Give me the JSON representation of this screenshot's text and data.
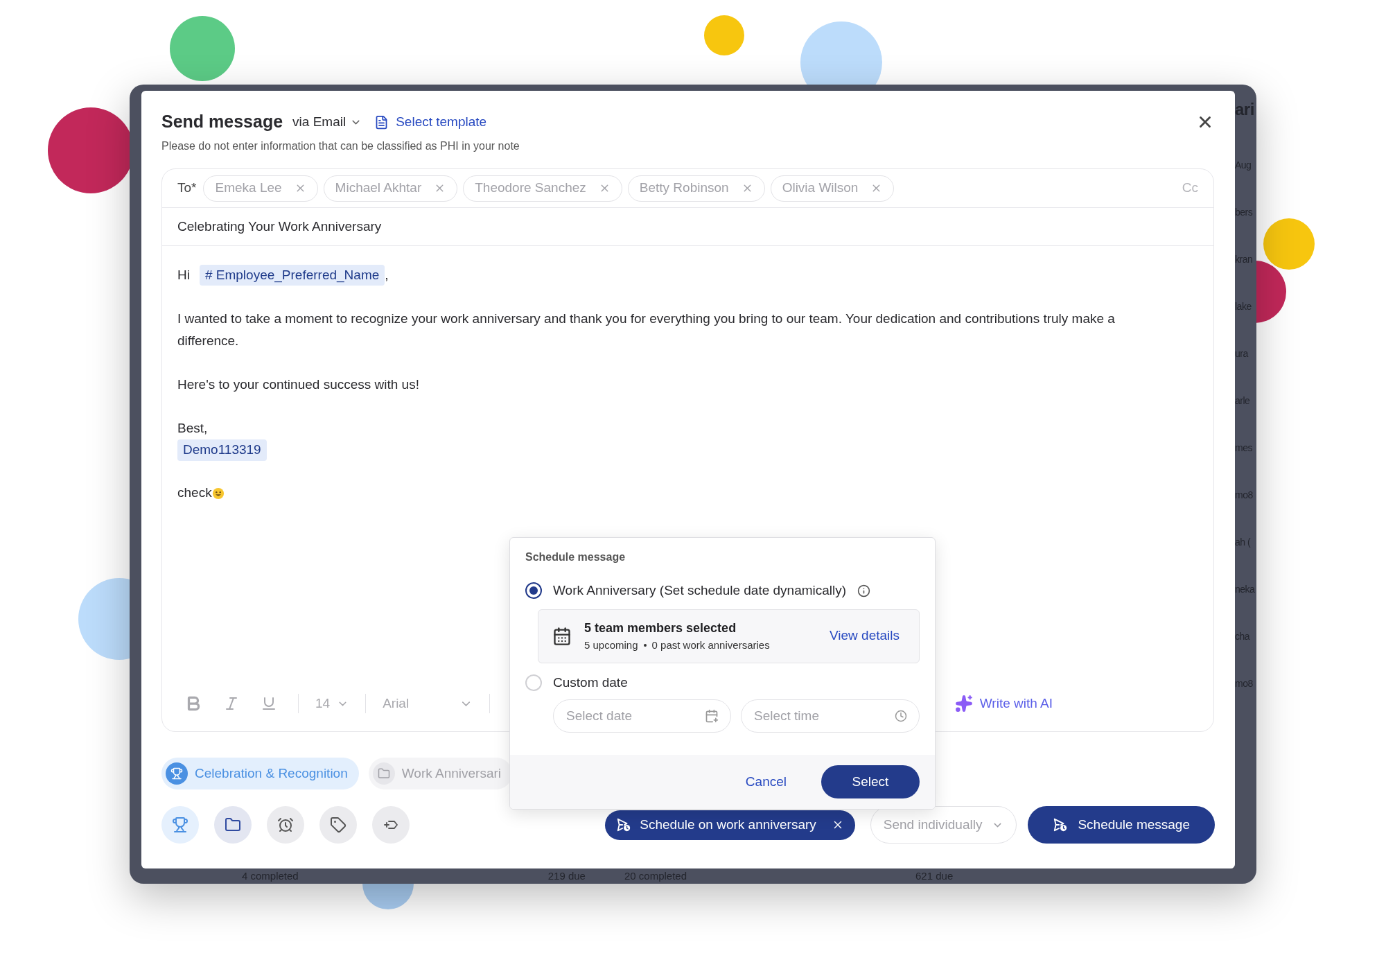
{
  "background": {
    "right_column": [
      "ari",
      "Aug",
      "bers",
      "kran",
      "lake",
      "ura",
      "arle",
      "mes",
      "mo8",
      "ah (",
      "neka",
      "cha",
      "mo8"
    ],
    "footer": [
      "4 completed",
      "219 due",
      "20 completed",
      "621 due"
    ]
  },
  "dialog": {
    "title": "Send message",
    "channel": "via Email",
    "template_link": "Select template",
    "notice": "Please do not enter information that can be classified as PHI in your note",
    "to_label": "To*",
    "recipients": [
      "Emeka Lee",
      "Michael Akhtar",
      "Theodore Sanchez",
      "Betty Robinson",
      "Olivia Wilson"
    ],
    "cc": "Cc",
    "subject": "Celebrating Your Work Anniversary",
    "body": [
      {
        "kind": "greeting",
        "text": "Hi",
        "tag": "# Employee_Preferred_Name",
        "after": ","
      },
      {
        "kind": "paragraph",
        "text": "I wanted to take a moment to recognize your work anniversary and thank you for everything you bring to our team. Your dedication and contributions truly make a difference."
      },
      {
        "kind": "paragraph",
        "text": "Here's to your continued success with us!"
      },
      {
        "kind": "signoff",
        "text": "Best,",
        "tag": "Demo113319"
      },
      {
        "kind": "emoji_line",
        "text": "check"
      }
    ],
    "toolbar": {
      "font_size": "14",
      "font": "Arial",
      "ai_button": "Write with AI"
    },
    "tags": [
      {
        "label": "Celebration & Recognition",
        "selected": true
      },
      {
        "label": "Work Anniversari",
        "selected": false
      }
    ],
    "action_icons": [
      {
        "kind": "trophy"
      },
      {
        "kind": "folder"
      },
      {
        "kind": "alarm"
      },
      {
        "kind": "tag"
      },
      {
        "kind": "label_plus"
      }
    ],
    "schedule_chip": "Schedule on work anniversary",
    "send_mode": "Send individually",
    "primary": "Schedule message"
  },
  "schedule_popover": {
    "title": "Schedule message",
    "options": [
      {
        "kind": "dynamic",
        "label": "Work Anniversary (Set schedule date dynamically)",
        "selected": true
      },
      {
        "kind": "custom",
        "label": "Custom date",
        "selected": false
      }
    ],
    "summary": {
      "title": "5 team members selected",
      "upcoming": "5 upcoming",
      "past": "0 past work anniversaries",
      "link": "View details"
    },
    "date_placeholder": "Select date",
    "time_placeholder": "Select time",
    "cancel": "Cancel",
    "confirm": "Select"
  }
}
